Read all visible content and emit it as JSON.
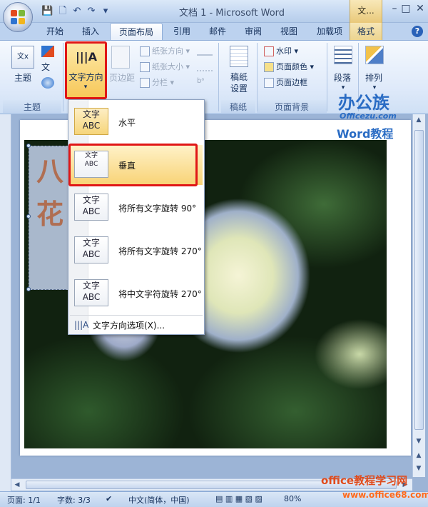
{
  "window": {
    "title": "文档 1 - Microsoft Word",
    "context_tab_top": "文...",
    "minimize": "–",
    "maximize": "□",
    "close": "✕"
  },
  "quick_access": {
    "save": "💾",
    "new": "🗋",
    "undo": "↶",
    "redo": "↷",
    "customize": "▾"
  },
  "tabs": [
    {
      "label": "开始",
      "active": false
    },
    {
      "label": "插入",
      "active": false
    },
    {
      "label": "页面布局",
      "active": true
    },
    {
      "label": "引用",
      "active": false
    },
    {
      "label": "邮件",
      "active": false
    },
    {
      "label": "审阅",
      "active": false
    },
    {
      "label": "视图",
      "active": false
    },
    {
      "label": "加载项",
      "active": false
    },
    {
      "label": "格式",
      "active": false,
      "contextual": true
    }
  ],
  "help": "?",
  "ribbon": {
    "themes": {
      "label": "主题",
      "button": "主题",
      "group_label": "主题"
    },
    "page_setup": {
      "text_direction": "文字方向",
      "margins": "页边距",
      "orientation": "纸张方向",
      "size": "纸张大小",
      "columns": "分栏"
    },
    "manuscript": {
      "button": "稿纸\n设置",
      "group_label": "稿纸"
    },
    "page_background": {
      "watermark": "水印",
      "page_color": "页面颜色",
      "page_borders": "页面边框",
      "group_label": "页面背景"
    },
    "paragraph": {
      "button": "段落"
    },
    "arrange": {
      "button": "排列"
    }
  },
  "dropdown": {
    "items": [
      {
        "icon_text": "文字\nABC",
        "label": "水平"
      },
      {
        "icon_text": "文字\nABC",
        "label": "垂直"
      },
      {
        "icon_text": "文字\nABC",
        "label": "将所有文字旋转 90°"
      },
      {
        "icon_text": "文字\nABC",
        "label": "将所有文字旋转 270°"
      },
      {
        "icon_text": "文字\nABC",
        "label": "将中文字符旋转 270°"
      }
    ],
    "options": "文字方向选项(X)..."
  },
  "document": {
    "textbox_chars": [
      "八",
      "花"
    ]
  },
  "brand": {
    "name": "办公族",
    "url": "Officezu.com",
    "subtitle": "Word教程"
  },
  "status": {
    "page": "页面: 1/1",
    "words": "字数: 3/3",
    "language": "中文(简体，中国)",
    "zoom": "80%"
  },
  "watermark": {
    "line1": "office教程学习网",
    "line2": "www.office68.com"
  },
  "colors": {
    "accent_red": "#e01616",
    "brand_blue": "#2a6cc4",
    "watermark_orange": "#e04b1c"
  }
}
